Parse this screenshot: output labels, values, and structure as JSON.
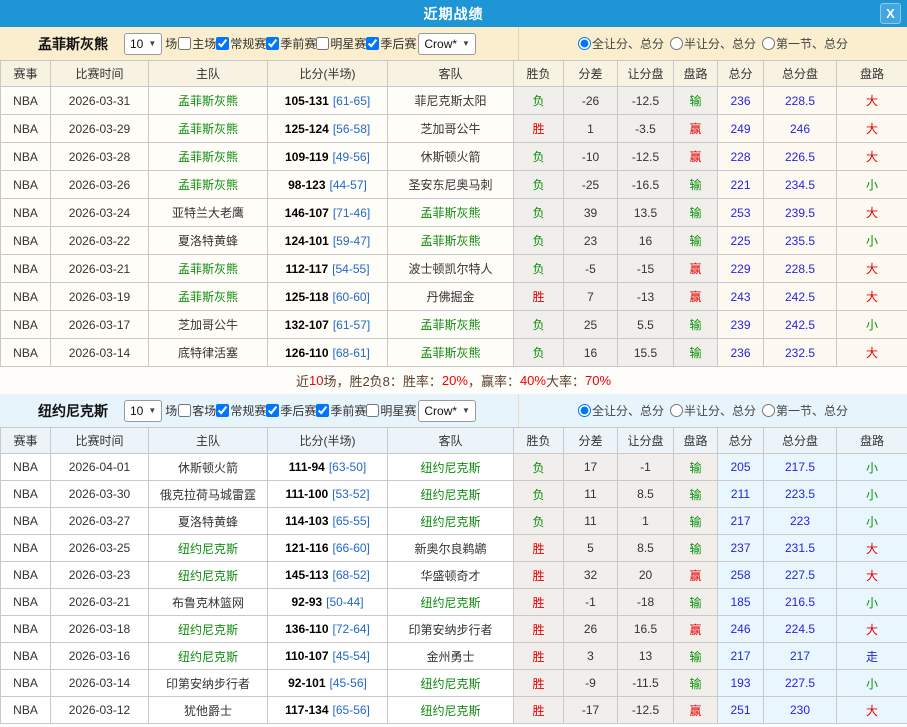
{
  "window": {
    "title": "近期战绩",
    "close_label": "X"
  },
  "colors": {
    "title_bar": "#1e95d4",
    "win_red": "#e60000",
    "loss_green": "#089008",
    "total_blue": "#2525dd",
    "half_score_blue": "#2268cc",
    "focus_team_green": "#0f8a0f",
    "section1_bg": "#faeecf",
    "section2_bg": "#e8f4fb"
  },
  "sections": [
    {
      "team": "孟菲斯灰熊",
      "games_count": "10",
      "games_suffix": "场",
      "filters": [
        {
          "label": "主场",
          "checked": false
        },
        {
          "label": "常规赛",
          "checked": true
        },
        {
          "label": "季前赛",
          "checked": true
        },
        {
          "label": "明星赛",
          "checked": false
        },
        {
          "label": "季后赛",
          "checked": true
        }
      ],
      "source_select": "Crow*",
      "radio_options": [
        {
          "label": "全让分、总分",
          "selected": true
        },
        {
          "label": "半让分、总分",
          "selected": false
        },
        {
          "label": "第一节、总分",
          "selected": false
        }
      ],
      "columns": [
        "赛事",
        "比赛时间",
        "主队",
        "比分(半场)",
        "客队",
        "胜负",
        "分差",
        "让分盘",
        "盘路",
        "总分",
        "总分盘",
        "盘路"
      ],
      "rows": [
        {
          "league": "NBA",
          "date": "2026-03-31",
          "home": "孟菲斯灰熊",
          "home_focus": true,
          "score": "105-131",
          "half": "[61-65]",
          "away": "菲尼克斯太阳",
          "away_focus": false,
          "result": "负",
          "margin": "-26",
          "handicap": "-12.5",
          "handicap_result": "输",
          "total": "236",
          "total_line": "228.5",
          "ou_result": "大"
        },
        {
          "league": "NBA",
          "date": "2026-03-29",
          "home": "孟菲斯灰熊",
          "home_focus": true,
          "score": "125-124",
          "half": "[56-58]",
          "away": "芝加哥公牛",
          "away_focus": false,
          "result": "胜",
          "margin": "1",
          "handicap": "-3.5",
          "handicap_result": "赢",
          "total": "249",
          "total_line": "246",
          "ou_result": "大"
        },
        {
          "league": "NBA",
          "date": "2026-03-28",
          "home": "孟菲斯灰熊",
          "home_focus": true,
          "score": "109-119",
          "half": "[49-56]",
          "away": "休斯顿火箭",
          "away_focus": false,
          "result": "负",
          "margin": "-10",
          "handicap": "-12.5",
          "handicap_result": "赢",
          "total": "228",
          "total_line": "226.5",
          "ou_result": "大"
        },
        {
          "league": "NBA",
          "date": "2026-03-26",
          "home": "孟菲斯灰熊",
          "home_focus": true,
          "score": "98-123",
          "half": "[44-57]",
          "away": "圣安东尼奥马刺",
          "away_focus": false,
          "result": "负",
          "margin": "-25",
          "handicap": "-16.5",
          "handicap_result": "输",
          "total": "221",
          "total_line": "234.5",
          "ou_result": "小"
        },
        {
          "league": "NBA",
          "date": "2026-03-24",
          "home": "亚特兰大老鹰",
          "home_focus": false,
          "score": "146-107",
          "half": "[71-46]",
          "away": "孟菲斯灰熊",
          "away_focus": true,
          "result": "负",
          "margin": "39",
          "handicap": "13.5",
          "handicap_result": "输",
          "total": "253",
          "total_line": "239.5",
          "ou_result": "大"
        },
        {
          "league": "NBA",
          "date": "2026-03-22",
          "home": "夏洛特黄蜂",
          "home_focus": false,
          "score": "124-101",
          "half": "[59-47]",
          "away": "孟菲斯灰熊",
          "away_focus": true,
          "result": "负",
          "margin": "23",
          "handicap": "16",
          "handicap_result": "输",
          "total": "225",
          "total_line": "235.5",
          "ou_result": "小"
        },
        {
          "league": "NBA",
          "date": "2026-03-21",
          "home": "孟菲斯灰熊",
          "home_focus": true,
          "score": "112-117",
          "half": "[54-55]",
          "away": "波士顿凯尔特人",
          "away_focus": false,
          "result": "负",
          "margin": "-5",
          "handicap": "-15",
          "handicap_result": "赢",
          "total": "229",
          "total_line": "228.5",
          "ou_result": "大"
        },
        {
          "league": "NBA",
          "date": "2026-03-19",
          "home": "孟菲斯灰熊",
          "home_focus": true,
          "score": "125-118",
          "half": "[60-60]",
          "away": "丹佛掘金",
          "away_focus": false,
          "result": "胜",
          "margin": "7",
          "handicap": "-13",
          "handicap_result": "赢",
          "total": "243",
          "total_line": "242.5",
          "ou_result": "大"
        },
        {
          "league": "NBA",
          "date": "2026-03-17",
          "home": "芝加哥公牛",
          "home_focus": false,
          "score": "132-107",
          "half": "[61-57]",
          "away": "孟菲斯灰熊",
          "away_focus": true,
          "result": "负",
          "margin": "25",
          "handicap": "5.5",
          "handicap_result": "输",
          "total": "239",
          "total_line": "242.5",
          "ou_result": "小"
        },
        {
          "league": "NBA",
          "date": "2026-03-14",
          "home": "底特律活塞",
          "home_focus": false,
          "score": "126-110",
          "half": "[68-61]",
          "away": "孟菲斯灰熊",
          "away_focus": true,
          "result": "负",
          "margin": "16",
          "handicap": "15.5",
          "handicap_result": "输",
          "total": "236",
          "total_line": "232.5",
          "ou_result": "大"
        }
      ],
      "summary_parts": [
        {
          "text": "近 ",
          "hl": false
        },
        {
          "text": "10",
          "hl": true
        },
        {
          "text": " 场，胜2负8：胜率：",
          "hl": false
        },
        {
          "text": "20%",
          "hl": true
        },
        {
          "text": "，赢率：",
          "hl": false
        },
        {
          "text": "40%",
          "hl": true
        },
        {
          "text": " 大率：",
          "hl": false
        },
        {
          "text": "70%",
          "hl": true
        }
      ]
    },
    {
      "team": "纽约尼克斯",
      "games_count": "10",
      "games_suffix": "场",
      "filters": [
        {
          "label": "客场",
          "checked": false
        },
        {
          "label": "常规赛",
          "checked": true
        },
        {
          "label": "季后赛",
          "checked": true
        },
        {
          "label": "季前赛",
          "checked": true
        },
        {
          "label": "明星赛",
          "checked": false
        }
      ],
      "source_select": "Crow*",
      "radio_options": [
        {
          "label": "全让分、总分",
          "selected": true
        },
        {
          "label": "半让分、总分",
          "selected": false
        },
        {
          "label": "第一节、总分",
          "selected": false
        }
      ],
      "columns": [
        "赛事",
        "比赛时间",
        "主队",
        "比分(半场)",
        "客队",
        "胜负",
        "分差",
        "让分盘",
        "盘路",
        "总分",
        "总分盘",
        "盘路"
      ],
      "rows": [
        {
          "league": "NBA",
          "date": "2026-04-01",
          "home": "休斯顿火箭",
          "home_focus": false,
          "score": "111-94",
          "half": "[63-50]",
          "away": "纽约尼克斯",
          "away_focus": true,
          "result": "负",
          "margin": "17",
          "handicap": "-1",
          "handicap_result": "输",
          "total": "205",
          "total_line": "217.5",
          "ou_result": "小"
        },
        {
          "league": "NBA",
          "date": "2026-03-30",
          "home": "俄克拉荷马城雷霆",
          "home_focus": false,
          "score": "111-100",
          "half": "[53-52]",
          "away": "纽约尼克斯",
          "away_focus": true,
          "result": "负",
          "margin": "11",
          "handicap": "8.5",
          "handicap_result": "输",
          "total": "211",
          "total_line": "223.5",
          "ou_result": "小"
        },
        {
          "league": "NBA",
          "date": "2026-03-27",
          "home": "夏洛特黄蜂",
          "home_focus": false,
          "score": "114-103",
          "half": "[65-55]",
          "away": "纽约尼克斯",
          "away_focus": true,
          "result": "负",
          "margin": "11",
          "handicap": "1",
          "handicap_result": "输",
          "total": "217",
          "total_line": "223",
          "ou_result": "小"
        },
        {
          "league": "NBA",
          "date": "2026-03-25",
          "home": "纽约尼克斯",
          "home_focus": true,
          "score": "121-116",
          "half": "[66-60]",
          "away": "新奥尔良鹈鹕",
          "away_focus": false,
          "result": "胜",
          "margin": "5",
          "handicap": "8.5",
          "handicap_result": "输",
          "total": "237",
          "total_line": "231.5",
          "ou_result": "大"
        },
        {
          "league": "NBA",
          "date": "2026-03-23",
          "home": "纽约尼克斯",
          "home_focus": true,
          "score": "145-113",
          "half": "[68-52]",
          "away": "华盛顿奇才",
          "away_focus": false,
          "result": "胜",
          "margin": "32",
          "handicap": "20",
          "handicap_result": "赢",
          "total": "258",
          "total_line": "227.5",
          "ou_result": "大"
        },
        {
          "league": "NBA",
          "date": "2026-03-21",
          "home": "布鲁克林篮网",
          "home_focus": false,
          "score": "92-93",
          "half": "[50-44]",
          "away": "纽约尼克斯",
          "away_focus": true,
          "result": "胜",
          "margin": "-1",
          "handicap": "-18",
          "handicap_result": "输",
          "total": "185",
          "total_line": "216.5",
          "ou_result": "小"
        },
        {
          "league": "NBA",
          "date": "2026-03-18",
          "home": "纽约尼克斯",
          "home_focus": true,
          "score": "136-110",
          "half": "[72-64]",
          "away": "印第安纳步行者",
          "away_focus": false,
          "result": "胜",
          "margin": "26",
          "handicap": "16.5",
          "handicap_result": "赢",
          "total": "246",
          "total_line": "224.5",
          "ou_result": "大"
        },
        {
          "league": "NBA",
          "date": "2026-03-16",
          "home": "纽约尼克斯",
          "home_focus": true,
          "score": "110-107",
          "half": "[45-54]",
          "away": "金州勇士",
          "away_focus": false,
          "result": "胜",
          "margin": "3",
          "handicap": "13",
          "handicap_result": "输",
          "total": "217",
          "total_line": "217",
          "ou_result": "走"
        },
        {
          "league": "NBA",
          "date": "2026-03-14",
          "home": "印第安纳步行者",
          "home_focus": false,
          "score": "92-101",
          "half": "[45-56]",
          "away": "纽约尼克斯",
          "away_focus": true,
          "result": "胜",
          "margin": "-9",
          "handicap": "-11.5",
          "handicap_result": "输",
          "total": "193",
          "total_line": "227.5",
          "ou_result": "小"
        },
        {
          "league": "NBA",
          "date": "2026-03-12",
          "home": "犹他爵士",
          "home_focus": false,
          "score": "117-134",
          "half": "[65-56]",
          "away": "纽约尼克斯",
          "away_focus": true,
          "result": "胜",
          "margin": "-17",
          "handicap": "-12.5",
          "handicap_result": "赢",
          "total": "251",
          "total_line": "230",
          "ou_result": "大"
        }
      ],
      "summary_parts": []
    }
  ]
}
